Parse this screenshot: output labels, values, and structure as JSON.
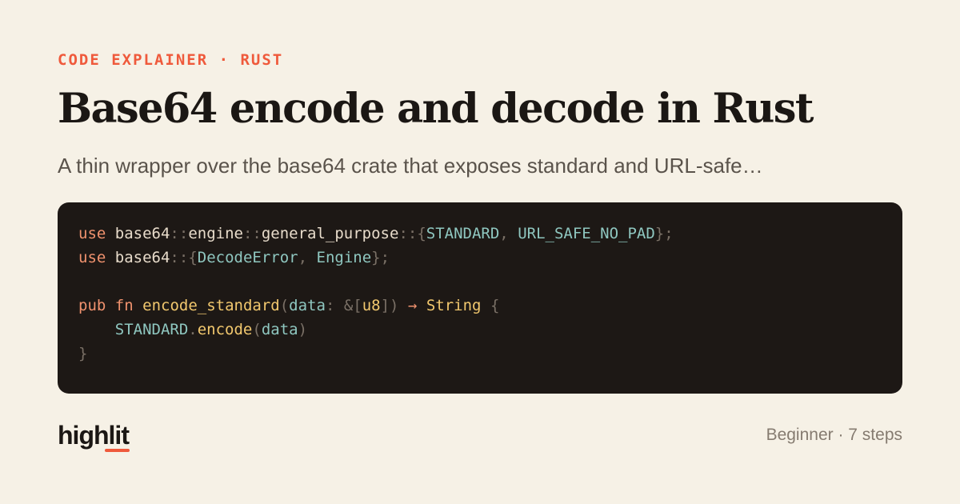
{
  "header": {
    "eyebrow": "CODE EXPLAINER · RUST",
    "title": "Base64 encode and decode in Rust",
    "subtitle": "A thin wrapper over the base64 crate that exposes standard and URL-safe…"
  },
  "code": {
    "lines": [
      [
        {
          "t": "use",
          "c": "kw"
        },
        {
          "t": " ",
          "c": "id"
        },
        {
          "t": "base64",
          "c": "id"
        },
        {
          "t": "::",
          "c": "pn"
        },
        {
          "t": "engine",
          "c": "id"
        },
        {
          "t": "::",
          "c": "pn"
        },
        {
          "t": "general_purpose",
          "c": "id"
        },
        {
          "t": "::",
          "c": "pn"
        },
        {
          "t": "{",
          "c": "pn"
        },
        {
          "t": "STANDARD",
          "c": "ty"
        },
        {
          "t": ", ",
          "c": "pn"
        },
        {
          "t": "URL_SAFE_NO_PAD",
          "c": "ty"
        },
        {
          "t": "};",
          "c": "pn"
        }
      ],
      [
        {
          "t": "use",
          "c": "kw"
        },
        {
          "t": " ",
          "c": "id"
        },
        {
          "t": "base64",
          "c": "id"
        },
        {
          "t": "::",
          "c": "pn"
        },
        {
          "t": "{",
          "c": "pn"
        },
        {
          "t": "DecodeError",
          "c": "ty"
        },
        {
          "t": ", ",
          "c": "pn"
        },
        {
          "t": "Engine",
          "c": "ty"
        },
        {
          "t": "};",
          "c": "pn"
        }
      ],
      [],
      [
        {
          "t": "pub",
          "c": "kw"
        },
        {
          "t": " ",
          "c": "id"
        },
        {
          "t": "fn",
          "c": "kw"
        },
        {
          "t": " ",
          "c": "id"
        },
        {
          "t": "encode_standard",
          "c": "fnn"
        },
        {
          "t": "(",
          "c": "pn"
        },
        {
          "t": "data",
          "c": "pr"
        },
        {
          "t": ": ",
          "c": "pn"
        },
        {
          "t": "&[",
          "c": "pn"
        },
        {
          "t": "u8",
          "c": "st"
        },
        {
          "t": "])",
          "c": "pn"
        },
        {
          "t": " ",
          "c": "id"
        },
        {
          "t": "→",
          "c": "kw"
        },
        {
          "t": " ",
          "c": "id"
        },
        {
          "t": "String",
          "c": "st"
        },
        {
          "t": " ",
          "c": "id"
        },
        {
          "t": "{",
          "c": "pn"
        }
      ],
      [
        {
          "t": "    ",
          "c": "id"
        },
        {
          "t": "STANDARD",
          "c": "ty"
        },
        {
          "t": ".",
          "c": "pn"
        },
        {
          "t": "encode",
          "c": "fnn"
        },
        {
          "t": "(",
          "c": "pn"
        },
        {
          "t": "data",
          "c": "pr"
        },
        {
          "t": ")",
          "c": "pn"
        }
      ],
      [
        {
          "t": "}",
          "c": "pn"
        }
      ]
    ]
  },
  "footer": {
    "logo": "highlit",
    "meta": "Beginner · 7 steps"
  },
  "colors": {
    "background": "#f6f1e6",
    "accent": "#ef5a3c",
    "code_background": "#1d1815"
  }
}
